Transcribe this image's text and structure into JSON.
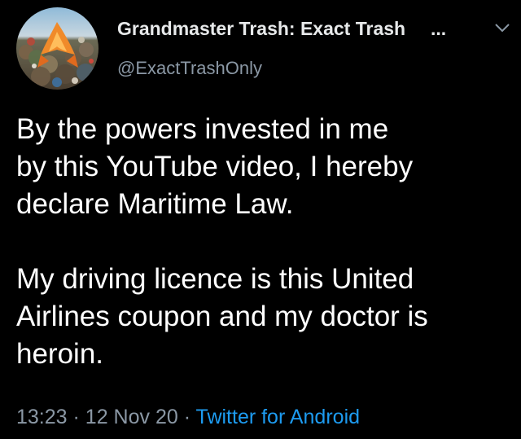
{
  "tweet": {
    "display_name": "Grandmaster Trash: Exact Trash",
    "name_truncation": "...",
    "handle": "@ExactTrashOnly",
    "body_lines_1": [
      "By the powers invested in me",
      "by this YouTube video, I hereby",
      "declare Maritime Law."
    ],
    "body_lines_2": [
      "My driving licence is this United",
      "Airlines coupon and my doctor is",
      "heroin."
    ],
    "time": "13:23",
    "separator": "·",
    "date": "12 Nov 20",
    "source": "Twitter for Android"
  },
  "icons": {
    "avatar": "avatar-trash-pile-icon",
    "menu": "chevron-down-icon"
  },
  "colors": {
    "background": "#000000",
    "text": "#ffffff",
    "secondary": "#8b98a5",
    "link": "#1d9bf0"
  }
}
